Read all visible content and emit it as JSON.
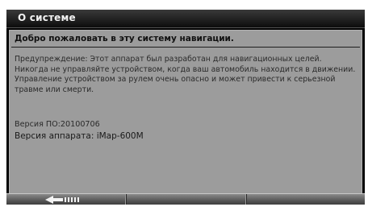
{
  "window": {
    "title": "О системе"
  },
  "content": {
    "heading": "Добро пожаловать в эту систему навигации.",
    "warning": "Предупреждение: Этот аппарат был разработан для навигационных целей. Никогда не управляйте устройством, когда ваш автомобиль находится в движении. Управление устройством за рулем очень опасно и может привести к серьезной травме или смерти.",
    "software_version": "Версия ПО:20100706",
    "hardware_version": "Версия аппарата: iMap-600M"
  },
  "toolbar": {
    "buttons": [
      {
        "icon": "back-arrow-icon"
      },
      {
        "icon": null
      },
      {
        "icon": null
      }
    ]
  }
}
